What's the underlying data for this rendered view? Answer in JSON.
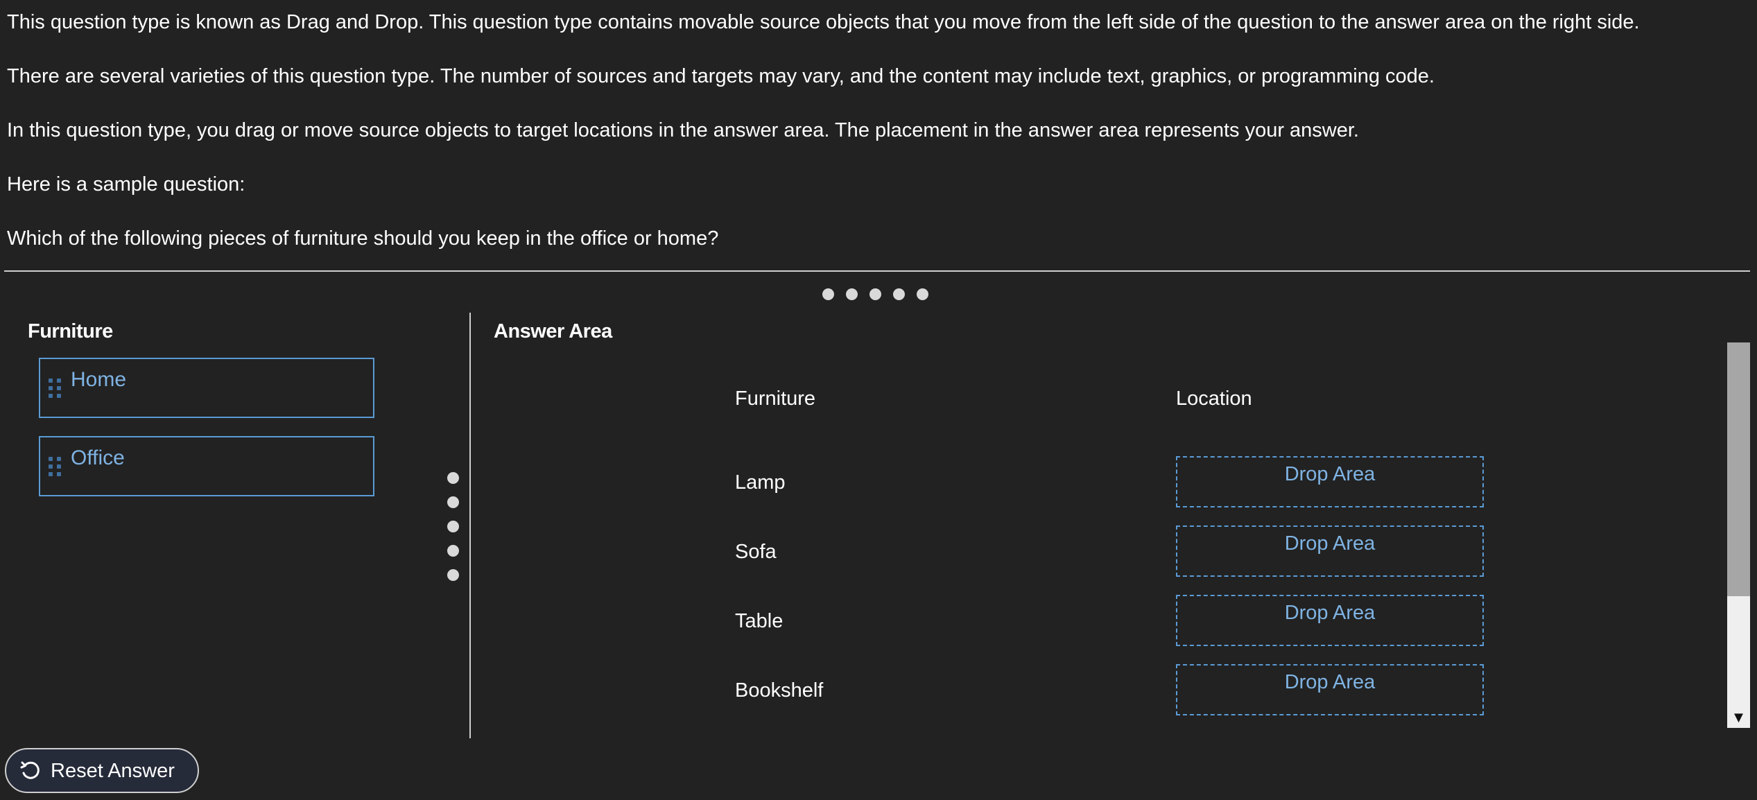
{
  "intro": {
    "p1": "This question type is known as Drag and Drop. This question type contains movable source objects that you move from the left side of the question to the answer area on the right side.",
    "p2": "There are several varieties of this question type. The number of sources and targets may vary, and the content may include text, graphics, or programming code.",
    "p3": "In this question type, you drag or move source objects to target locations in the answer area. The placement in the answer area represents your answer.",
    "p4": "Here is a sample question:",
    "p5": "Which of the following pieces of furniture should you keep in the office or home?"
  },
  "source_pane": {
    "title": "Furniture",
    "items": [
      {
        "label": "Home"
      },
      {
        "label": "Office"
      }
    ]
  },
  "answer_area": {
    "title": "Answer Area",
    "col_furniture": "Furniture",
    "col_location": "Location",
    "rows": [
      {
        "item": "Lamp",
        "drop_label": "Drop Area"
      },
      {
        "item": "Sofa",
        "drop_label": "Drop Area"
      },
      {
        "item": "Table",
        "drop_label": "Drop Area"
      },
      {
        "item": "Bookshelf",
        "drop_label": "Drop Area"
      }
    ]
  },
  "reset_button": {
    "label": "Reset Answer",
    "icon": "reset-icon"
  },
  "icons": {
    "drag_handle": "drag-handle-icon",
    "splitter_horizontal": "resize-handle-horizontal",
    "splitter_vertical": "resize-handle-vertical",
    "scroll_down": "arrow-down-icon"
  },
  "colors": {
    "background": "#222222",
    "accent": "#5b9bd5",
    "accent_text": "#7fb3e3",
    "text": "#ffffff"
  }
}
